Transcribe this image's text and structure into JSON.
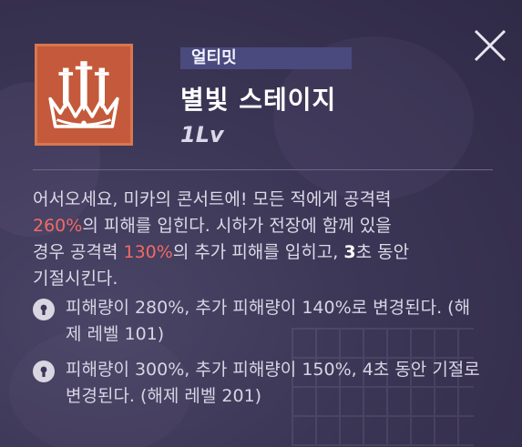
{
  "skill": {
    "type_label": "얼티밋",
    "name": "별빛 스테이지",
    "level": "1Lv",
    "icon": "crown-of-swords-icon"
  },
  "description": {
    "line1": "어서오세요, 미카의 콘서트에! 모든 적에게 공격력",
    "value1": "260%",
    "line2": "의 피해를 입힌다. 시하가 전장에 함께 있을",
    "line3": "경우 공격력 ",
    "value2": "130%",
    "line4": "의 추가 피해를 입히고, ",
    "value3": "3",
    "line5": "초 동안",
    "line6": "기절시킨다."
  },
  "unlocks": [
    {
      "icon": "lock-icon",
      "text": "피해량이 280%, 추가 피해량이 140%로 변경된다. (해제 레벨 101)"
    },
    {
      "icon": "lock-icon",
      "text": "피해량이 300%, 추가 피해량이 150%, 4초 동안 기절로 변경된다. (해제 레벨 201)"
    }
  ],
  "colors": {
    "highlight": "#f26a64",
    "icon_background": "#c45a3b",
    "tag_background": "#4a4a7e"
  }
}
